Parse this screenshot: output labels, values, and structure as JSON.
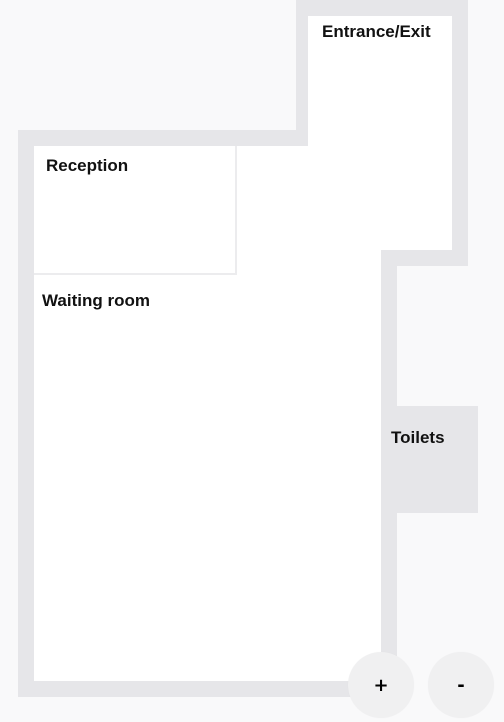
{
  "floorplan": {
    "rooms": [
      {
        "id": "entrance",
        "label": "Entrance/Exit"
      },
      {
        "id": "reception",
        "label": "Reception"
      },
      {
        "id": "waiting",
        "label": "Waiting room"
      },
      {
        "id": "toilets",
        "label": "Toilets"
      }
    ],
    "colors": {
      "background": "#f9f9fa",
      "wall": "#e6e6e9",
      "room_fill": "#ffffff",
      "toilets_fill": "#e6e6e9",
      "label_text": "#111111"
    }
  },
  "zoom_controls": {
    "zoom_in_label": "+",
    "zoom_out_label": "-"
  }
}
